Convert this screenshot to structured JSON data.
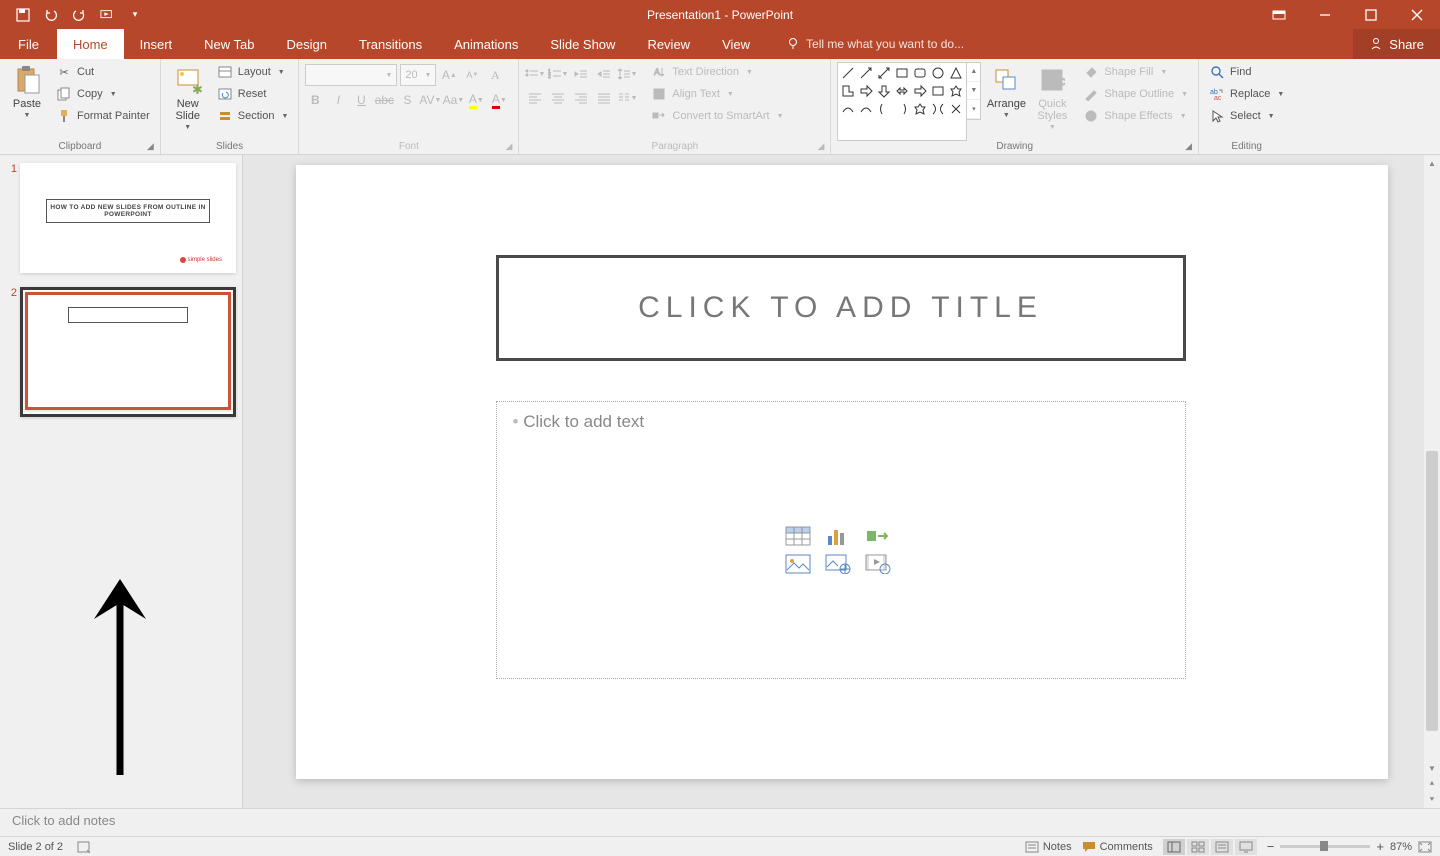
{
  "title": "Presentation1 - PowerPoint",
  "tabs": {
    "file": "File",
    "home": "Home",
    "insert": "Insert",
    "newtab": "New Tab",
    "design": "Design",
    "transitions": "Transitions",
    "animations": "Animations",
    "slideshow": "Slide Show",
    "review": "Review",
    "view": "View"
  },
  "tellme": "Tell me what you want to do...",
  "share": "Share",
  "clipboard": {
    "label": "Clipboard",
    "paste": "Paste",
    "cut": "Cut",
    "copy": "Copy",
    "format_painter": "Format Painter"
  },
  "slides": {
    "label": "Slides",
    "new_slide": "New\nSlide",
    "layout": "Layout",
    "reset": "Reset",
    "section": "Section"
  },
  "font": {
    "label": "Font",
    "size": "20"
  },
  "paragraph": {
    "label": "Paragraph",
    "text_direction": "Text Direction",
    "align_text": "Align Text",
    "smartart": "Convert to SmartArt"
  },
  "drawing": {
    "label": "Drawing",
    "arrange": "Arrange",
    "quick_styles": "Quick\nStyles",
    "shape_fill": "Shape Fill",
    "shape_outline": "Shape Outline",
    "shape_effects": "Shape Effects"
  },
  "editing": {
    "label": "Editing",
    "find": "Find",
    "replace": "Replace",
    "select": "Select"
  },
  "thumbs": {
    "t1_num": "1",
    "t1_title": "HOW TO ADD NEW SLIDES FROM OUTLINE IN POWERPOINT",
    "t1_brand": "simple slides",
    "t2_num": "2"
  },
  "canvas": {
    "title_ph": "CLICK TO ADD TITLE",
    "body_ph": "Click to add text"
  },
  "notes_ph": "Click to add notes",
  "status": {
    "slide": "Slide 2 of 2",
    "notes": "Notes",
    "comments": "Comments",
    "zoom": "87%"
  }
}
